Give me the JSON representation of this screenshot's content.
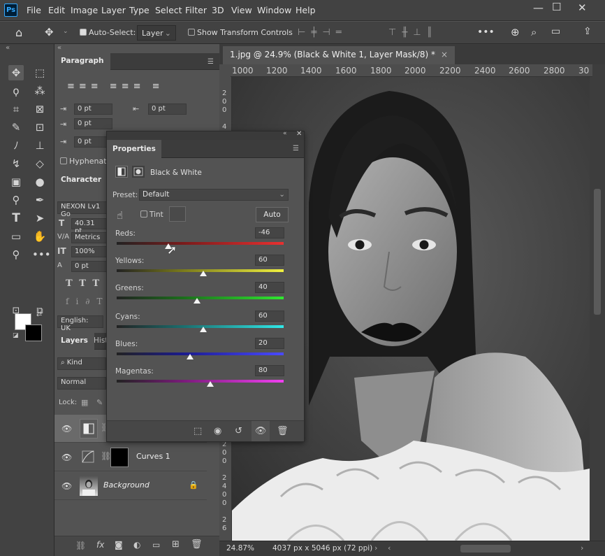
{
  "app": {
    "logo": "Ps"
  },
  "menu": [
    "File",
    "Edit",
    "Image",
    "Layer",
    "Type",
    "Select",
    "Filter",
    "3D",
    "View",
    "Window",
    "Help"
  ],
  "options": {
    "auto_select_label": "Auto-Select:",
    "auto_select_target": "Layer",
    "show_transform_label": "Show Transform Controls"
  },
  "paragraph": {
    "tab": "Paragraph",
    "indent_left": "0 pt",
    "indent_right": "0 pt",
    "indent_first": "0 pt",
    "space_before": "0 pt",
    "space_after": "0 pt",
    "hyphenate": "Hyphenate"
  },
  "character": {
    "tab": "Character",
    "font": "NEXON Lv1 Go",
    "size": "40.31 pt",
    "kerning": "Metrics",
    "vscale": "100%",
    "baseline": "0 pt",
    "language": "English: UK"
  },
  "layers": {
    "tabs": [
      "Layers",
      "Hist"
    ],
    "filter": "Kind",
    "blend": "Normal",
    "lock_label": "Lock:",
    "items": [
      {
        "name": ""
      },
      {
        "name": "Curves 1"
      },
      {
        "name": "Background"
      }
    ]
  },
  "document": {
    "tab_title": "1.jpg @ 24.9% (Black & White 1, Layer Mask/8) *",
    "zoom": "24.87%",
    "dimensions": "4037 px x 5046 px (72 ppi)",
    "ruler_marks": [
      "1000",
      "1200",
      "1400",
      "1600",
      "1800",
      "2000",
      "2200",
      "2400",
      "2600",
      "2800",
      "30"
    ]
  },
  "properties": {
    "title": "Properties",
    "adjustment": "Black & White",
    "preset_label": "Preset:",
    "preset": "Default",
    "tint_label": "Tint",
    "auto_label": "Auto",
    "sliders": [
      {
        "label": "Reds:",
        "value": "-46",
        "min": -200,
        "max": 300,
        "num": -46
      },
      {
        "label": "Yellows:",
        "value": "60",
        "min": -200,
        "max": 300,
        "num": 60
      },
      {
        "label": "Greens:",
        "value": "40",
        "min": -200,
        "max": 300,
        "num": 40
      },
      {
        "label": "Cyans:",
        "value": "60",
        "min": -200,
        "max": 300,
        "num": 60
      },
      {
        "label": "Blues:",
        "value": "20",
        "min": -200,
        "max": 300,
        "num": 20
      },
      {
        "label": "Magentas:",
        "value": "80",
        "min": -200,
        "max": 300,
        "num": 80
      }
    ]
  }
}
